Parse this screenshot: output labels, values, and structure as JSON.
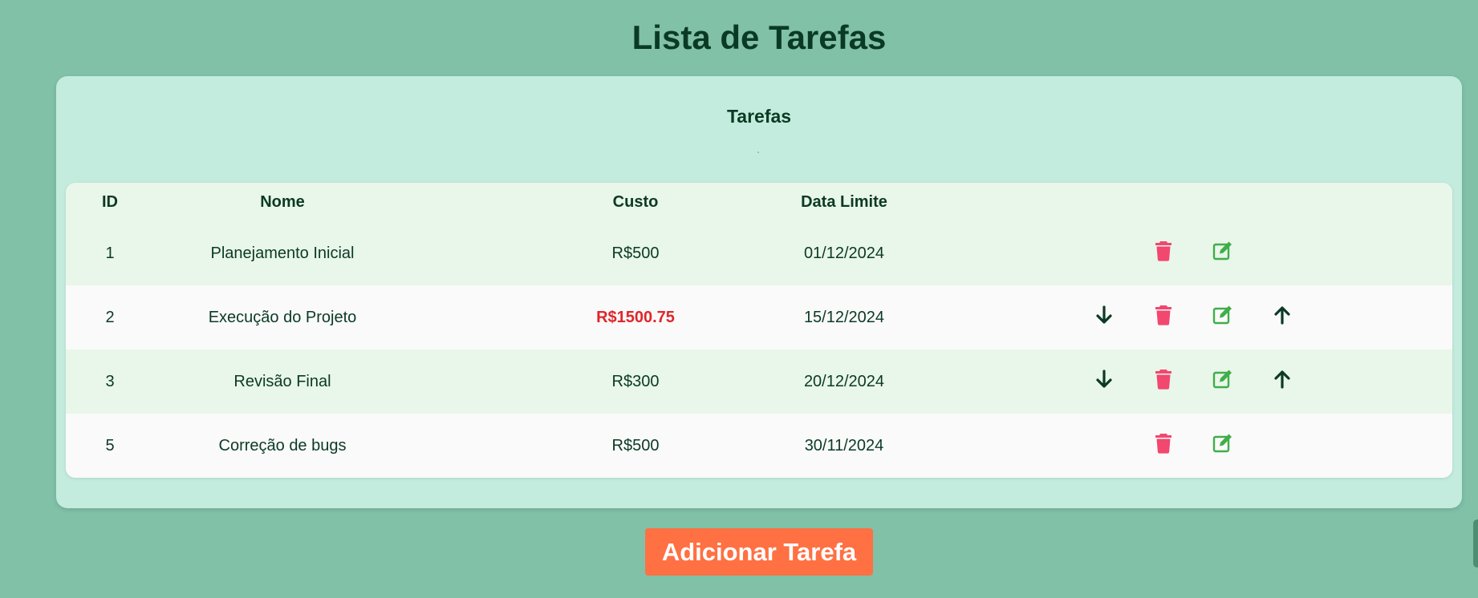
{
  "page": {
    "title": "Lista de Tarefas"
  },
  "panel": {
    "title": "Tarefas"
  },
  "table": {
    "headers": {
      "id": "ID",
      "nome": "Nome",
      "custo": "Custo",
      "data_limite": "Data Limite"
    },
    "rows": [
      {
        "id": "1",
        "nome": "Planejamento Inicial",
        "custo": "R$500",
        "data_limite": "01/12/2024"
      },
      {
        "id": "2",
        "nome": "Execução do Projeto",
        "custo": "R$1500.75",
        "data_limite": "15/12/2024",
        "custo_highlight": true
      },
      {
        "id": "3",
        "nome": "Revisão Final",
        "custo": "R$300",
        "data_limite": "20/12/2024"
      },
      {
        "id": "5",
        "nome": "Correção de bugs",
        "custo": "R$500",
        "data_limite": "30/11/2024"
      }
    ],
    "row_actions": [
      [
        "trash-icon",
        "edit-icon"
      ],
      [
        "arrow-down-icon",
        "trash-icon",
        "edit-icon",
        "arrow-up-icon"
      ],
      [
        "arrow-down-icon",
        "trash-icon",
        "edit-icon",
        "arrow-up-icon"
      ],
      [
        "trash-icon",
        "edit-icon"
      ]
    ]
  },
  "actions": {
    "add_task_label": "Adicionar Tarefa"
  },
  "colors": {
    "background": "#80c1a8",
    "panel": "#c3ecde",
    "table_row_alt": "#e9f6ea",
    "table_row": "#fafafa",
    "text_dark": "#0b3a24",
    "cost_highlight": "#e0262b",
    "trash_icon": "#f2476f",
    "edit_icon": "#3fae49",
    "add_button": "#ff7043"
  }
}
